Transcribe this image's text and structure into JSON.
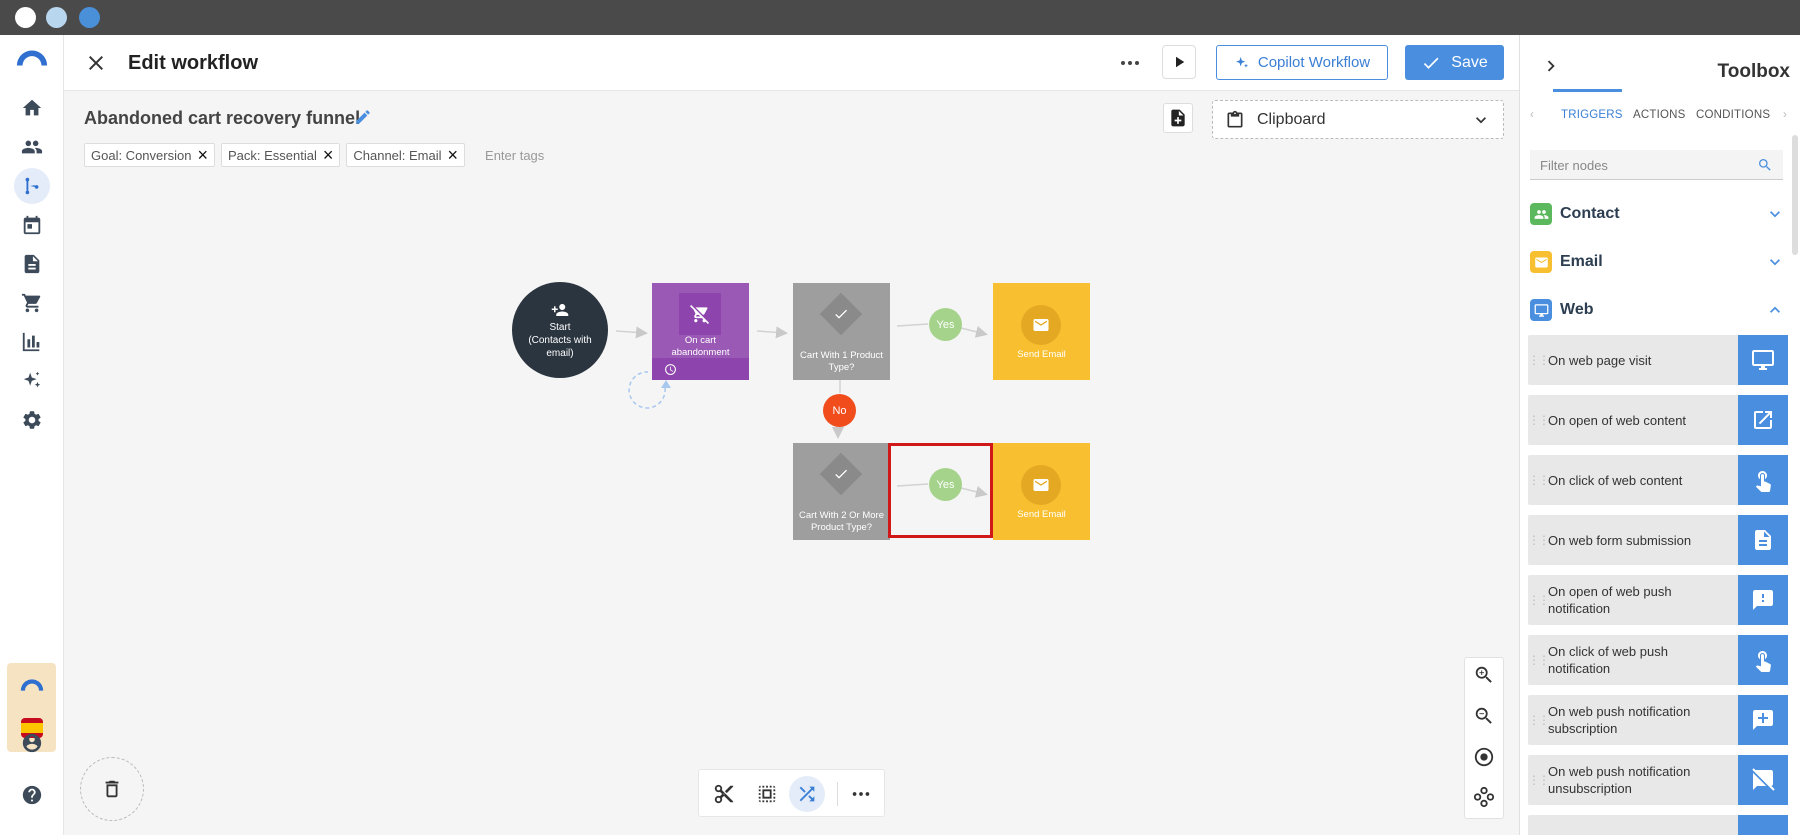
{
  "window": {
    "dots": [
      "#ffffff",
      "#b9d6ef",
      "#4a90d9"
    ]
  },
  "header": {
    "title": "Edit workflow",
    "copilot_label": "Copilot Workflow",
    "save_label": "Save"
  },
  "workflow": {
    "name": "Abandoned cart recovery funnel",
    "tags": [
      "Goal: Conversion",
      "Pack: Essential",
      "Channel: Email"
    ],
    "tags_placeholder": "Enter tags",
    "clipboard_label": "Clipboard"
  },
  "canvas": {
    "start_label": "Start",
    "start_sub": "(Contacts with email)",
    "trigger_label": "On cart abandonment",
    "cond1_label": "Cart With 1 Product Type?",
    "cond2_label": "Cart With 2 Or More Product Type?",
    "action1_label": "Send Email",
    "action2_label": "Send Email",
    "yes_label": "Yes",
    "no_label": "No"
  },
  "toolbox": {
    "title": "Toolbox",
    "tabs": [
      "TRIGGERS",
      "ACTIONS",
      "CONDITIONS"
    ],
    "active_tab": "TRIGGERS",
    "filter_placeholder": "Filter nodes",
    "categories": [
      {
        "label": "Contact",
        "color": "#5cb85c",
        "expanded": false
      },
      {
        "label": "Email",
        "color": "#f8c030",
        "expanded": false
      },
      {
        "label": "Web",
        "color": "#4a8fdf",
        "expanded": true
      }
    ],
    "items": [
      {
        "label": "On web page visit",
        "icon": "monitor-icon"
      },
      {
        "label": "On open of web content",
        "icon": "open-external-icon"
      },
      {
        "label": "On click of web content",
        "icon": "pointer-hand-icon"
      },
      {
        "label": "On web form submission",
        "icon": "document-icon"
      },
      {
        "label": "On open of web push notification",
        "icon": "alert-message-icon"
      },
      {
        "label": "On click of web push notification",
        "icon": "pointer-hand-icon"
      },
      {
        "label": "On web push notification subscription",
        "icon": "add-message-icon"
      },
      {
        "label": "On web push notification unsubscription",
        "icon": "remove-message-icon"
      }
    ]
  },
  "colors": {
    "accent": "#4a8fdf",
    "trigger": "#9b59b6",
    "condition": "#9e9e9e",
    "action": "#f8c030",
    "yes": "#a6d38c",
    "no": "#f04c1c",
    "selection": "#d01818"
  }
}
